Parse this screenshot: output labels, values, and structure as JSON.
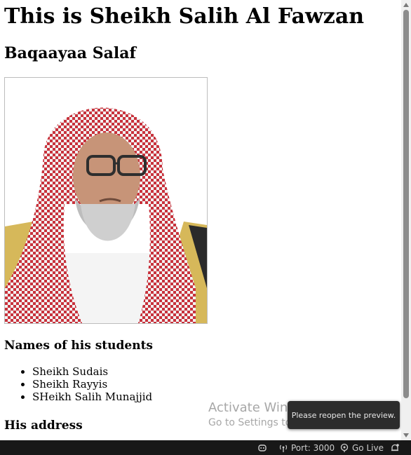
{
  "page": {
    "title": "This is Sheikh Salih Al Fawzan",
    "subtitle": "Baqaayaa Salaf",
    "students_heading": "Names of his students",
    "students": [
      "Sheikh Sudais",
      "Sheikh Rayyis",
      "SHeikh Salih Munajjid"
    ],
    "address_heading": "His address"
  },
  "photo": {
    "icon": "portrait-photo"
  },
  "watermark": {
    "line1": "Activate Windows",
    "line2": "Go to Settings to activate Windows."
  },
  "tooltip": {
    "text": "Please reopen the preview."
  },
  "statusbar": {
    "port_label": "Port: 3000",
    "golive_label": "Go Live",
    "copilot_icon": "copilot-icon",
    "broadcast_icon": "broadcast-icon",
    "golive_icon": "go-live-icon",
    "bell_icon": "notification-bell-icon"
  },
  "colors": {
    "statusbar_bg": "#181818",
    "statusbar_text": "#cccccc",
    "tooltip_bg": "#2c2c2c",
    "keffiyeh_red": "#c8323c"
  }
}
